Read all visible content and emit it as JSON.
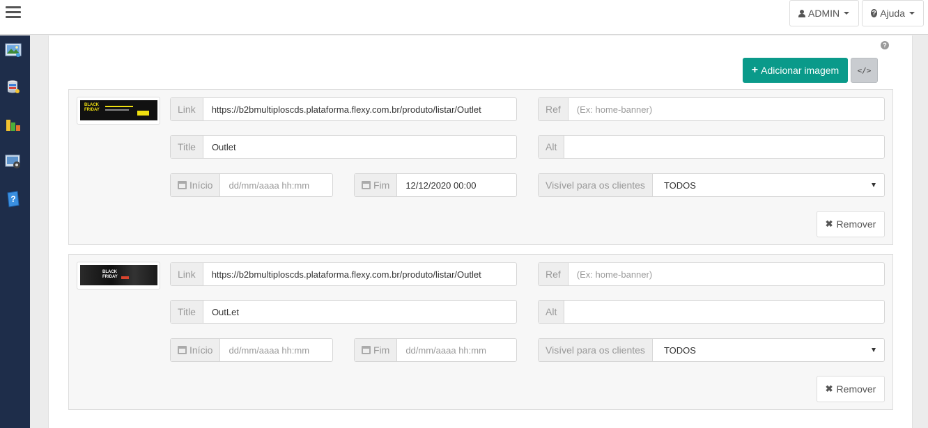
{
  "header": {
    "admin_label": "ADMIN",
    "help_label": "Ajuda"
  },
  "sidebar": {
    "icons": [
      "image-icon",
      "database-icon",
      "bar-chart-icon",
      "settings-screen-icon",
      "help-book-icon"
    ]
  },
  "toolbar": {
    "add_image_label": "Adicionar imagem",
    "code_label": "</>"
  },
  "banners": [
    {
      "link_label": "Link",
      "link_value": "https://b2bmultiploscds.plataforma.flexy.com.br/produto/listar/Outlet",
      "ref_label": "Ref",
      "ref_placeholder": "(Ex: home-banner)",
      "title_label": "Title",
      "title_value": "Outlet",
      "alt_label": "Alt",
      "alt_value": "",
      "inicio_label": "Início",
      "inicio_placeholder": "dd/mm/aaaa hh:mm",
      "fim_label": "Fim",
      "fim_value": "12/12/2020 00:00",
      "visivel_label": "Visível para os clientes",
      "visivel_value": "TODOS",
      "remove_label": "Remover",
      "thumb_text": "BLACK FRIDAY"
    },
    {
      "link_label": "Link",
      "link_value": "https://b2bmultiploscds.plataforma.flexy.com.br/produto/listar/Outlet",
      "ref_label": "Ref",
      "ref_placeholder": "(Ex: home-banner)",
      "title_label": "Title",
      "title_value": "OutLet",
      "alt_label": "Alt",
      "alt_value": "",
      "inicio_label": "Início",
      "inicio_placeholder": "dd/mm/aaaa hh:mm",
      "fim_label": "Fim",
      "fim_placeholder": "dd/mm/aaaa hh:mm",
      "visivel_label": "Visível para os clientes",
      "visivel_value": "TODOS",
      "remove_label": "Remover",
      "thumb_text": "BLACK FRIDAY"
    }
  ],
  "colors": {
    "primary_teal": "#0a9a8a",
    "sidebar_bg": "#1e2d4a"
  }
}
